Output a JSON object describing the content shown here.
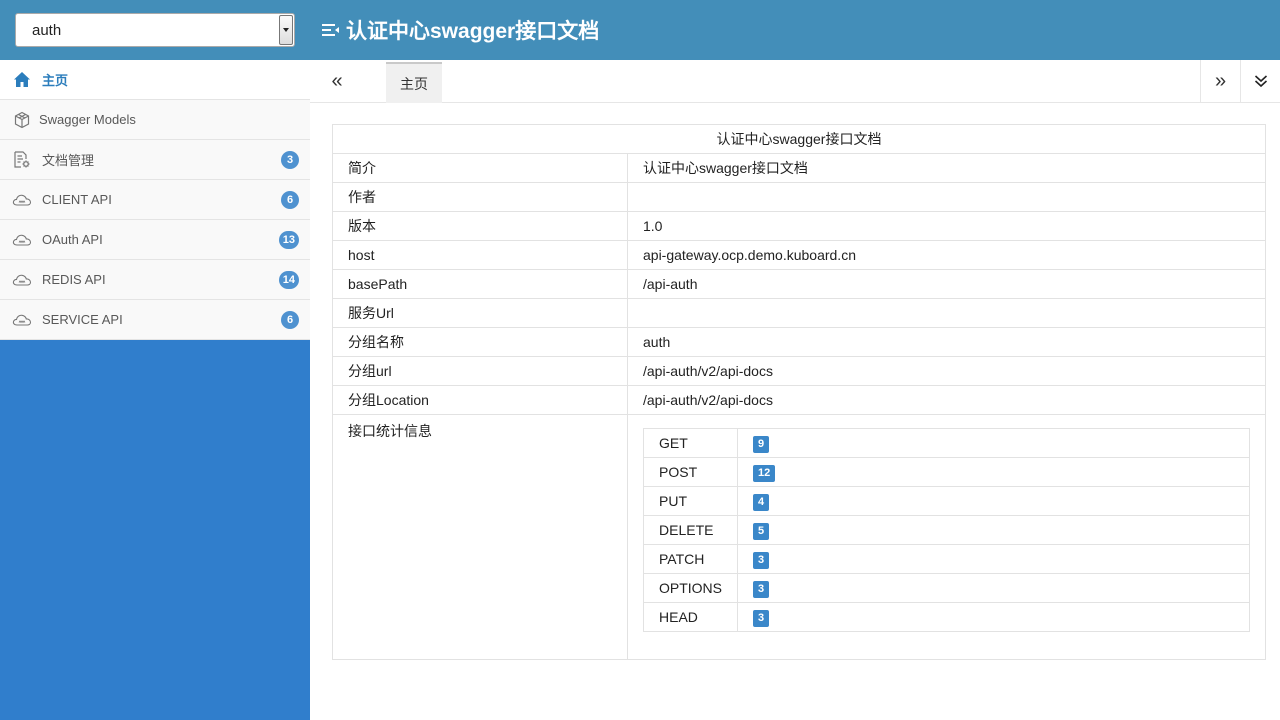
{
  "header": {
    "group_select_value": "auth",
    "title": "认证中心swagger接口文档"
  },
  "sidebar": {
    "items": [
      {
        "label": "主页",
        "icon": "home-icon",
        "badge": null,
        "active": true
      },
      {
        "label": "Swagger Models",
        "icon": "models-icon",
        "badge": null
      },
      {
        "label": "文档管理",
        "icon": "doc-settings-icon",
        "badge": "3"
      },
      {
        "label": "CLIENT API",
        "icon": "cloud-icon",
        "badge": "6"
      },
      {
        "label": "OAuth API",
        "icon": "cloud-icon",
        "badge": "13"
      },
      {
        "label": "REDIS API",
        "icon": "cloud-icon",
        "badge": "14"
      },
      {
        "label": "SERVICE API",
        "icon": "cloud-icon",
        "badge": "6"
      }
    ]
  },
  "tabs": {
    "left_nav": "«",
    "right_nav": "»",
    "items": [
      {
        "label": "主页"
      }
    ]
  },
  "doc": {
    "title": "认证中心swagger接口文档",
    "rows": [
      {
        "key": "简介",
        "value": "认证中心swagger接口文档"
      },
      {
        "key": "作者",
        "value": ""
      },
      {
        "key": "版本",
        "value": "1.0"
      },
      {
        "key": "host",
        "value": "api-gateway.ocp.demo.kuboard.cn"
      },
      {
        "key": "basePath",
        "value": "/api-auth"
      },
      {
        "key": "服务Url",
        "value": ""
      },
      {
        "key": "分组名称",
        "value": "auth"
      },
      {
        "key": "分组url",
        "value": "/api-auth/v2/api-docs"
      },
      {
        "key": "分组Location",
        "value": "/api-auth/v2/api-docs"
      }
    ],
    "stats_label": "接口统计信息",
    "stats": [
      {
        "method": "GET",
        "count": "9"
      },
      {
        "method": "POST",
        "count": "12"
      },
      {
        "method": "PUT",
        "count": "4"
      },
      {
        "method": "DELETE",
        "count": "5"
      },
      {
        "method": "PATCH",
        "count": "3"
      },
      {
        "method": "OPTIONS",
        "count": "3"
      },
      {
        "method": "HEAD",
        "count": "3"
      }
    ]
  },
  "colors": {
    "header_bg": "#438EB9",
    "sidebar_bg": "#307ECC",
    "badge": "#4F92D0",
    "active_text": "#2B7DBC"
  }
}
